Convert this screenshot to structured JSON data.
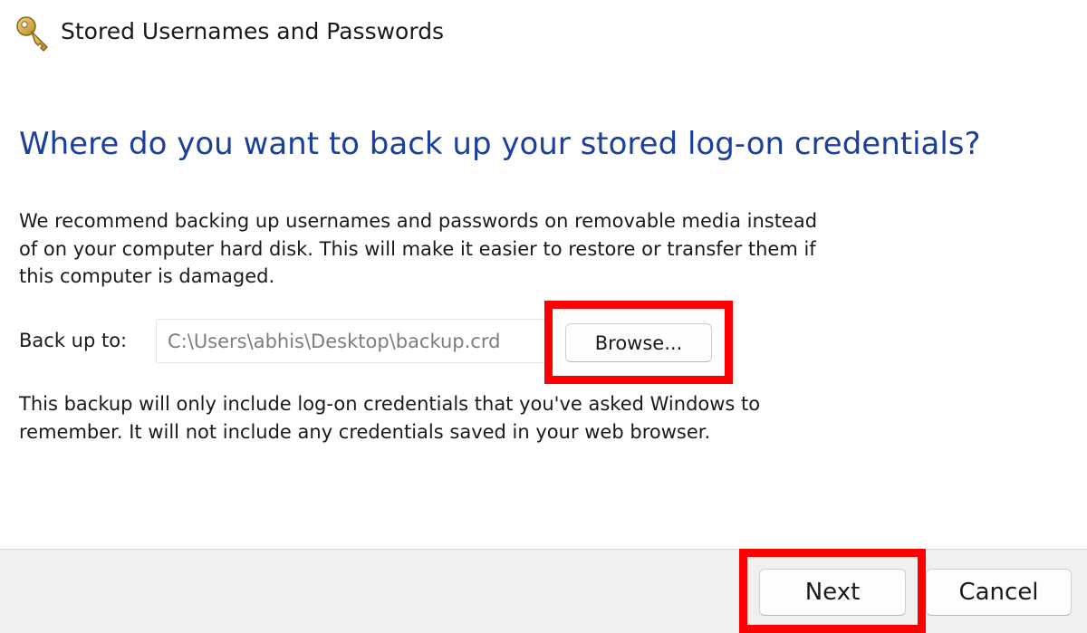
{
  "window": {
    "title": "Stored Usernames and Passwords",
    "icon": "key-icon"
  },
  "wizard": {
    "heading": "Where do you want to back up your stored log-on credentials?",
    "recommendation": "We recommend backing up usernames and passwords on removable media instead of on your computer hard disk. This will make it easier to restore or transfer them if this computer is damaged.",
    "backup_label": "Back up to:",
    "backup_path": "C:\\Users\\abhis\\Desktop\\backup.crd",
    "browse_label": "Browse...",
    "note": "This backup will only  include log-on credentials that you've asked Windows to remember. It will not include any credentials saved in your web browser."
  },
  "footer": {
    "next_label": "Next",
    "cancel_label": "Cancel"
  },
  "colors": {
    "heading": "#1b3f9e",
    "highlight": "#ff0000",
    "footer_bg": "#f0f0f0"
  }
}
